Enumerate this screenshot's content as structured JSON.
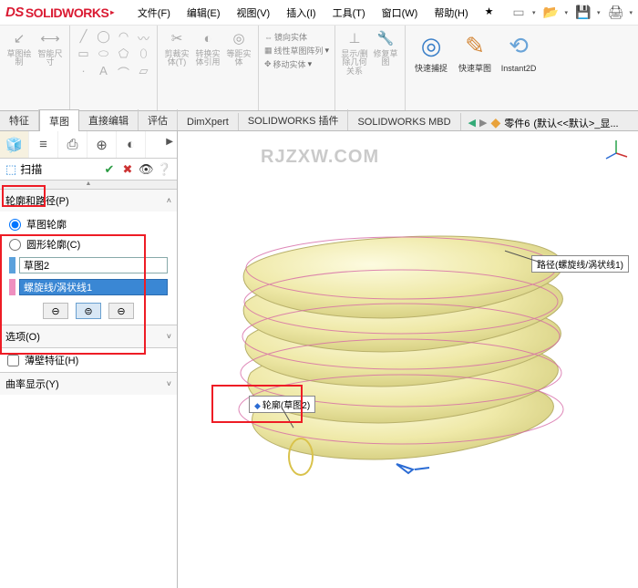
{
  "app": {
    "name": "SOLIDWORKS",
    "logo_prefix": "DS"
  },
  "menus": {
    "file": "文件(F)",
    "edit": "编辑(E)",
    "view": "视图(V)",
    "insert": "插入(I)",
    "tools": "工具(T)",
    "window": "窗口(W)",
    "help": "帮助(H)"
  },
  "ribbon": {
    "exit_sketch": "草图绘制",
    "smart_dim": "智能尺寸",
    "cut_entity": "剪裁实体(T)",
    "convert_entity": "转换实体引用",
    "equal_relation": "等距实体",
    "mirror": "镜向实体",
    "linear_pattern": "线性草图阵列",
    "move": "移动实体",
    "display_delete": "显示/删除几何关系",
    "repair": "修复草图",
    "quick_snap": "快速捕捉",
    "rapid_sketch": "快速草图",
    "instant2d": "Instant2D"
  },
  "cm_tabs": {
    "feature": "特征",
    "sketch": "草图",
    "direct_edit": "直接编辑",
    "evaluate": "评估",
    "dimxpert": "DimXpert",
    "sw_plugin": "SOLIDWORKS 插件",
    "sw_mbd": "SOLIDWORKS MBD"
  },
  "breadcrumb": {
    "part": "零件6",
    "state": "(默认<<默认>_显..."
  },
  "pm": {
    "title": "扫描",
    "section_profile": "轮廓和路径(P)",
    "radio_sketch_profile": "草图轮廓",
    "radio_circular_profile": "圆形轮廓(C)",
    "profile_value": "草图2",
    "path_value": "螺旋线/涡状线1",
    "section_options": "选项(O)",
    "thin_feature": "薄壁特征(H)",
    "curvature_display": "曲率显示(Y)"
  },
  "callouts": {
    "path": "路径(螺旋线/涡状线1)",
    "profile": "轮廓(草图2)"
  },
  "watermark": "RJZXW.COM"
}
